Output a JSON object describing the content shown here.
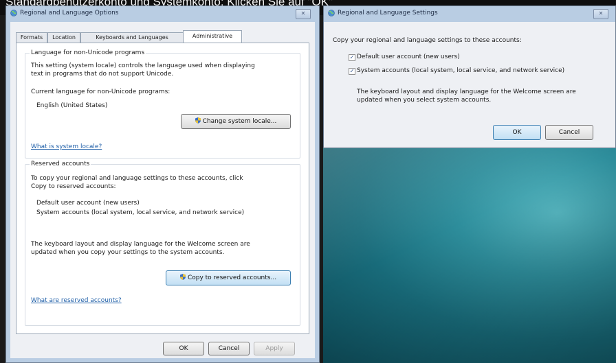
{
  "caption": "Standardbenutzerkonto und Systemkonto: Klicken Sie auf \"OK\"",
  "left_dialog": {
    "title": "Regional and Language Options",
    "close_glyph": "✕",
    "tabs": [
      {
        "label": "Formats"
      },
      {
        "label": "Location"
      },
      {
        "label": "Keyboards and Languages"
      },
      {
        "label": "Administrative"
      }
    ],
    "unicode_group": {
      "label": "Language for non-Unicode programs",
      "desc_line1": "This setting (system locale) controls the language used when displaying",
      "desc_line2": "text in programs that do not support Unicode.",
      "current_label": "Current language for non-Unicode programs:",
      "current_value": "English (United States)",
      "change_button": "Change system locale...",
      "link": "What is system locale?"
    },
    "reserved_group": {
      "label": "Reserved accounts",
      "desc_line1": "To copy your regional and language settings to these accounts, click",
      "desc_line2": "Copy to reserved accounts:",
      "account1": "Default user account (new users)",
      "account2": "System accounts (local system, local service, and network service)",
      "note_line1": "The keyboard layout and display language for the Welcome screen are",
      "note_line2": "updated when you copy your settings to the system accounts.",
      "copy_button": "Copy to reserved accounts...",
      "link": "What are reserved accounts?"
    },
    "buttons": {
      "ok": "OK",
      "cancel": "Cancel",
      "apply": "Apply"
    }
  },
  "right_dialog": {
    "title": "Regional and Language Settings",
    "close_glyph": "✕",
    "instruction": "Copy your regional and language settings to these accounts:",
    "checkbox1": {
      "label": "Default user account (new users)",
      "checked": true
    },
    "checkbox2": {
      "label": "System accounts (local system, local service, and network service)",
      "checked": true
    },
    "check_glyph": "✓",
    "note_line1": "The keyboard layout and display language for the Welcome screen are",
    "note_line2": "updated when you select system accounts.",
    "buttons": {
      "ok": "OK",
      "cancel": "Cancel"
    }
  }
}
